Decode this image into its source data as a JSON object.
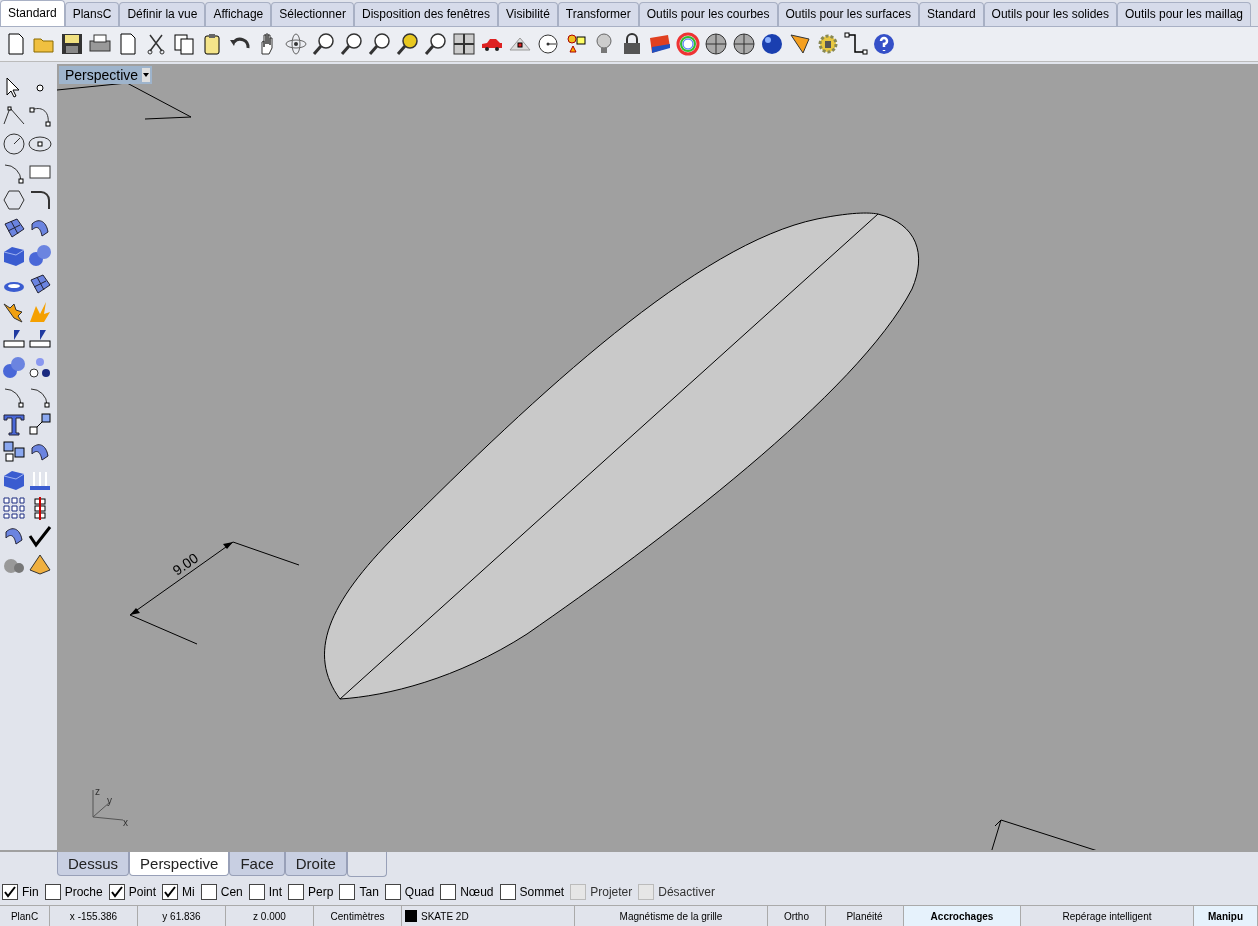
{
  "tabs": [
    {
      "label": "Standard",
      "selected": true
    },
    {
      "label": "PlansC",
      "selected": false
    },
    {
      "label": "Définir la vue",
      "selected": false
    },
    {
      "label": "Affichage",
      "selected": false
    },
    {
      "label": "Sélectionner",
      "selected": false
    },
    {
      "label": "Disposition des fenêtres",
      "selected": false
    },
    {
      "label": "Visibilité",
      "selected": false
    },
    {
      "label": "Transformer",
      "selected": false
    },
    {
      "label": "Outils pour les courbes",
      "selected": false
    },
    {
      "label": "Outils pour les surfaces",
      "selected": false
    },
    {
      "label": "Standard",
      "selected": false
    },
    {
      "label": "Outils pour les solides",
      "selected": false
    },
    {
      "label": "Outils pour les maillag",
      "selected": false
    }
  ],
  "viewport": {
    "title": "Perspective",
    "dimension_text": "9.00",
    "axis_labels": {
      "z": "z",
      "y": "y",
      "x": "x"
    }
  },
  "viewport_tabs": [
    {
      "label": "Dessus",
      "selected": false
    },
    {
      "label": "Perspective",
      "selected": true
    },
    {
      "label": "Face",
      "selected": false
    },
    {
      "label": "Droite",
      "selected": false
    }
  ],
  "osnaps": [
    {
      "label": "Fin",
      "checked": true,
      "disabled": false
    },
    {
      "label": "Proche",
      "checked": false,
      "disabled": false
    },
    {
      "label": "Point",
      "checked": true,
      "disabled": false
    },
    {
      "label": "Mi",
      "checked": true,
      "disabled": false
    },
    {
      "label": "Cen",
      "checked": false,
      "disabled": false
    },
    {
      "label": "Int",
      "checked": false,
      "disabled": false
    },
    {
      "label": "Perp",
      "checked": false,
      "disabled": false
    },
    {
      "label": "Tan",
      "checked": false,
      "disabled": false
    },
    {
      "label": "Quad",
      "checked": false,
      "disabled": false
    },
    {
      "label": "Nœud",
      "checked": false,
      "disabled": false
    },
    {
      "label": "Sommet",
      "checked": false,
      "disabled": false
    },
    {
      "label": "Projeter",
      "checked": false,
      "disabled": true
    },
    {
      "label": "Désactiver",
      "checked": false,
      "disabled": true
    }
  ],
  "status_bar": [
    {
      "kind": "text",
      "text": "PlanC"
    },
    {
      "kind": "text",
      "text": "x -155.386"
    },
    {
      "kind": "text",
      "text": "y 61.836"
    },
    {
      "kind": "text",
      "text": "z 0.000"
    },
    {
      "kind": "text",
      "text": "Centimètres"
    },
    {
      "kind": "layer",
      "text": "SKATE 2D",
      "color": "#000000"
    },
    {
      "kind": "toggle",
      "text": "Magnétisme de la grille",
      "on": false
    },
    {
      "kind": "toggle",
      "text": "Ortho",
      "on": false
    },
    {
      "kind": "toggle",
      "text": "Planéité",
      "on": false
    },
    {
      "kind": "toggle",
      "text": "Accrochages",
      "on": true
    },
    {
      "kind": "toggle",
      "text": "Repérage intelligent",
      "on": false
    },
    {
      "kind": "toggle",
      "text": "Manipu",
      "on": true
    }
  ]
}
